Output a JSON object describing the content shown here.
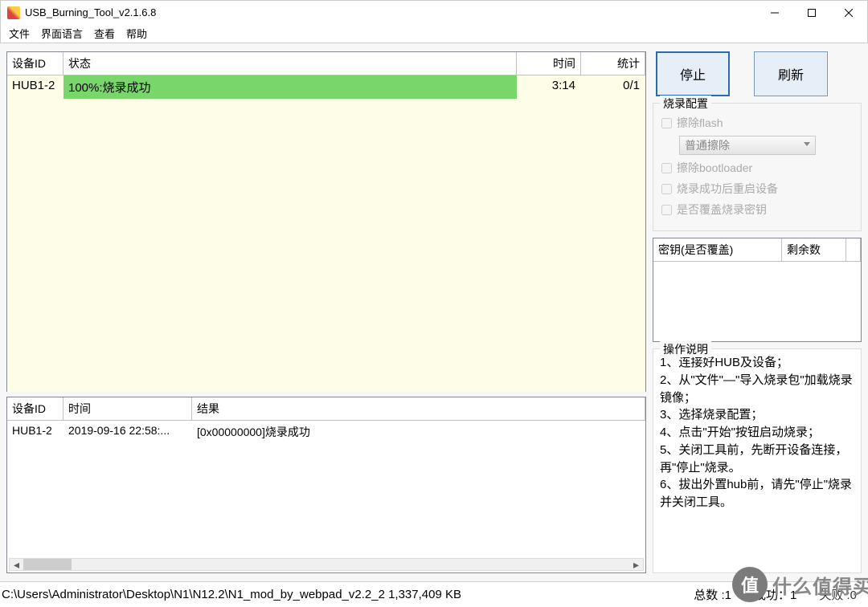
{
  "title": "USB_Burning_Tool_v2.1.6.8",
  "menus": {
    "file": "文件",
    "lang": "界面语言",
    "view": "查看",
    "help": "帮助"
  },
  "dev_headers": {
    "id": "设备ID",
    "status": "状态",
    "time": "时间",
    "stat": "统计"
  },
  "dev_rows": [
    {
      "id": "HUB1-2",
      "status": "100%:烧录成功",
      "time": "3:14",
      "stat": "0/1"
    }
  ],
  "log_headers": {
    "id": "设备ID",
    "time": "时间",
    "result": "结果"
  },
  "log_rows": [
    {
      "id": "HUB1-2",
      "time": "2019-09-16 22:58:...",
      "result": "[0x00000000]烧录成功"
    }
  ],
  "buttons": {
    "stop": "停止",
    "refresh": "刷新"
  },
  "config": {
    "legend": "烧录配置",
    "erase_flash": "擦除flash",
    "erase_mode": "普通擦除",
    "erase_bootloader": "擦除bootloader",
    "reboot_after": "烧录成功后重启设备",
    "overwrite_key": "是否覆盖烧录密钥"
  },
  "key_headers": {
    "a": "密钥(是否覆盖)",
    "b": "剩余数"
  },
  "instructions": {
    "legend": "操作说明",
    "l1": "1、连接好HUB及设备；",
    "l2": "2、从\"文件\"—\"导入烧录包\"加载烧录镜像；",
    "l3": "3、选择烧录配置；",
    "l4": "4、点击\"开始\"按钮启动烧录；",
    "l5": "5、关闭工具前，先断开设备连接，再\"停止\"烧录。",
    "l6": "6、拔出外置hub前，请先\"停止\"烧录并关闭工具。"
  },
  "status": {
    "path": "C:\\Users\\Administrator\\Desktop\\N1\\N12.2\\N1_mod_by_webpad_v2.2_2 1,337,409 KB",
    "total": "总数 :1",
    "success": "成功：1",
    "fail": "失败     :0"
  },
  "watermark": "什么值得买"
}
